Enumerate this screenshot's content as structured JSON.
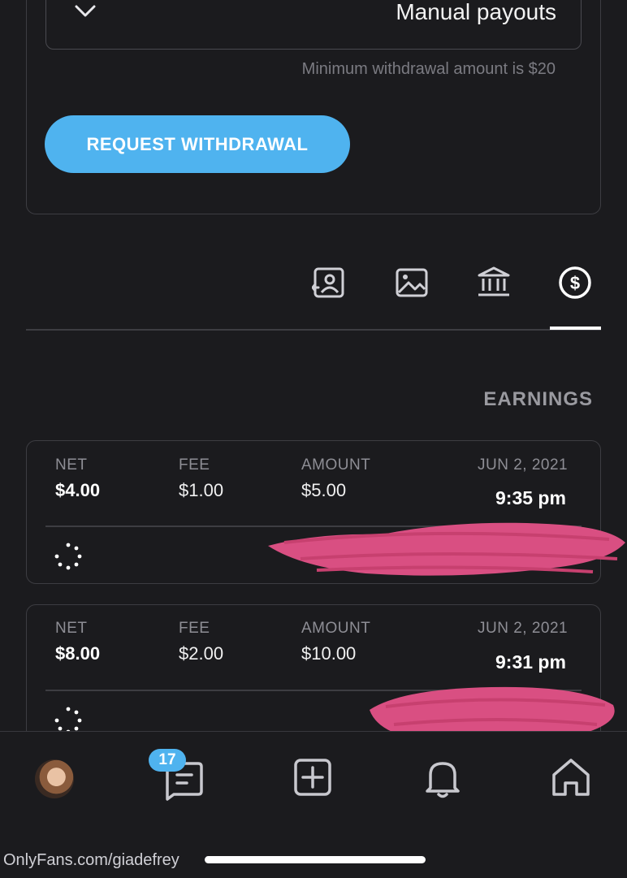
{
  "payout": {
    "select_value": "Manual payouts",
    "min_note": "Minimum withdrawal amount is $20",
    "request_button": "REQUEST WITHDRAWAL"
  },
  "tabs": [
    {
      "name": "earnings",
      "icon": "dollar-circle-icon",
      "active": true
    },
    {
      "name": "bank",
      "icon": "bank-icon",
      "active": false
    },
    {
      "name": "media",
      "icon": "image-icon",
      "active": false
    },
    {
      "name": "profile",
      "icon": "user-card-icon",
      "active": false
    }
  ],
  "earnings": {
    "title": "EARNINGS",
    "columns": {
      "date": "",
      "amount": "AMOUNT",
      "fee": "FEE",
      "net": "NET"
    },
    "rows": [
      {
        "date": "JUN 2, 2021",
        "time": "9:35 pm",
        "amount": "$5.00",
        "fee": "$1.00",
        "net": "$4.00"
      },
      {
        "date": "JUN 2, 2021",
        "time": "9:31 pm",
        "amount": "$10.00",
        "fee": "$2.00",
        "net": "$8.00"
      }
    ]
  },
  "bottom_nav": {
    "messages_badge": "17",
    "items": [
      "home-icon",
      "bell-icon",
      "plus-square-icon",
      "messages-icon",
      "avatar"
    ]
  },
  "footer": {
    "url": "OnlyFans.com/giadefrey"
  },
  "colors": {
    "accent": "#4fb3ef",
    "background": "#1b1b1e",
    "redaction": "#d94f82"
  }
}
